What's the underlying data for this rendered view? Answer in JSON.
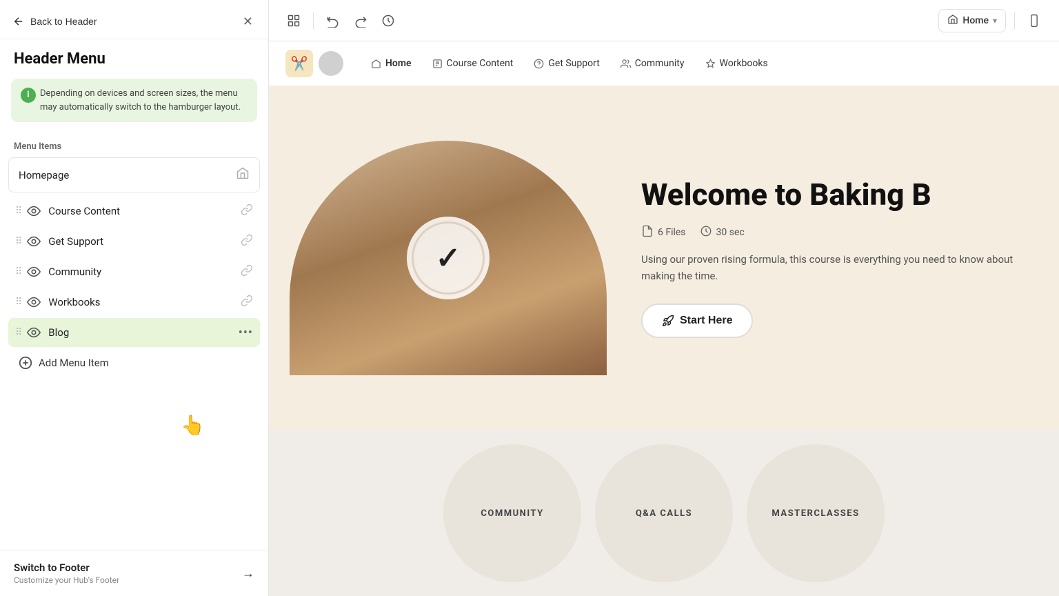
{
  "left_panel": {
    "back_btn": "Back to Header",
    "title": "Header Menu",
    "info_text": "Depending on devices and screen sizes, the menu may automatically switch to the hamburger layout.",
    "section_label": "Menu Items",
    "menu_items": [
      {
        "id": "homepage",
        "label": "Homepage",
        "icon": "home",
        "type": "homepage",
        "visible": true
      },
      {
        "id": "course-content",
        "label": "Course Content",
        "icon": "eye",
        "type": "link",
        "visible": true
      },
      {
        "id": "get-support",
        "label": "Get Support",
        "icon": "eye",
        "type": "link",
        "visible": true
      },
      {
        "id": "community",
        "label": "Community",
        "icon": "eye",
        "type": "link",
        "visible": true
      },
      {
        "id": "workbooks",
        "label": "Workbooks",
        "icon": "eye",
        "type": "link",
        "visible": true
      },
      {
        "id": "blog",
        "label": "Blog",
        "icon": "eye",
        "type": "link",
        "visible": true,
        "highlighted": true
      }
    ],
    "add_menu_item_label": "Add Menu Item",
    "switch_footer": {
      "title": "Switch to Footer",
      "subtitle": "Customize your Hub's Footer"
    }
  },
  "toolbar": {
    "undo_label": "Undo",
    "redo_label": "Redo",
    "history_label": "History",
    "home_label": "Home"
  },
  "site_nav": {
    "links": [
      "Home",
      "Course Content",
      "Get Support",
      "Community",
      "Workbooks"
    ]
  },
  "hero": {
    "title": "Welcome to Baking B",
    "files_count": "6 Files",
    "duration": "30 sec",
    "description": "Using our proven rising formula, this course is everything you need to know about making the time.",
    "cta_label": "Start Here"
  },
  "features": [
    {
      "label": "COMMUNITY"
    },
    {
      "label": "Q&A CALLS"
    },
    {
      "label": "MASTERCLASSES"
    }
  ]
}
